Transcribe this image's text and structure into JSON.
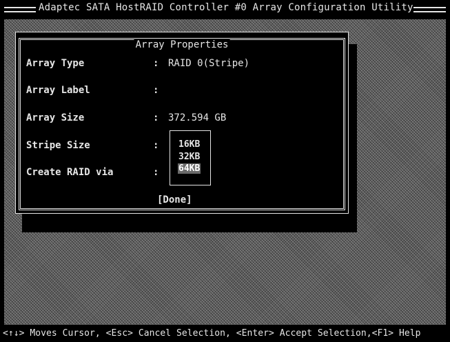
{
  "header": {
    "title": "Adaptec SATA HostRAID Controller #0 Array Configuration Utility"
  },
  "dialog": {
    "title": "Array Properties",
    "fields": [
      {
        "label": "Array Type",
        "colon": ":",
        "value": "RAID 0(Stripe)"
      },
      {
        "label": "Array Label",
        "colon": ":",
        "value": ""
      },
      {
        "label": "Array Size",
        "colon": ":",
        "value": "372.594 GB"
      },
      {
        "label": "Stripe Size",
        "colon": ":",
        "value": ""
      },
      {
        "label": "Create RAID via",
        "colon": ":",
        "value": ""
      }
    ],
    "stripe_options": [
      "16KB",
      "32KB",
      "64KB"
    ],
    "stripe_selected": "64KB",
    "done_label": "[Done]"
  },
  "footer": {
    "help": "<↑↓> Moves Cursor, <Esc> Cancel Selection, <Enter> Accept Selection,<F1> Help"
  }
}
